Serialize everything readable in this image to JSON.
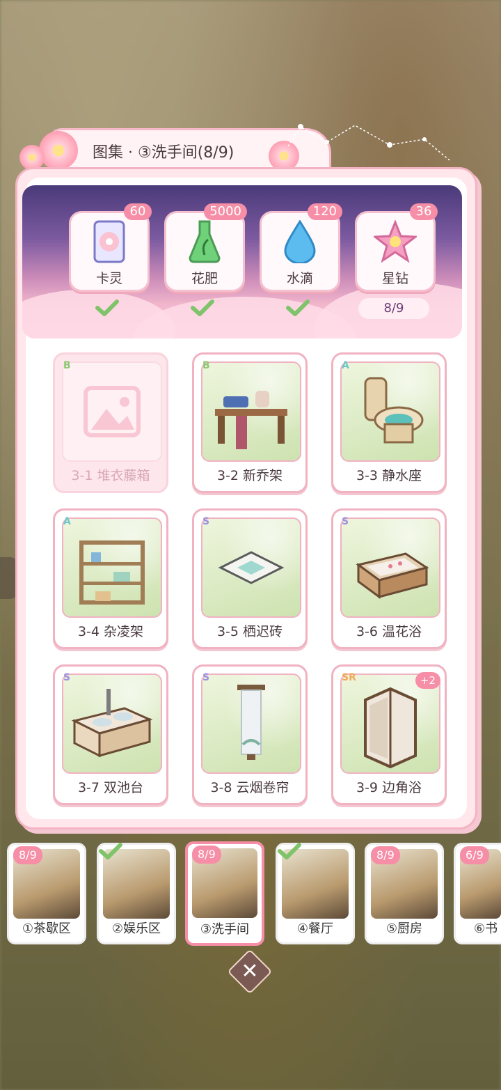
{
  "title": "图集 · ③洗手间(8/9)",
  "resources": [
    {
      "label": "卡灵",
      "badge": "60",
      "icon": "card-spirit-icon",
      "completed": true
    },
    {
      "label": "花肥",
      "badge": "5000",
      "icon": "fertilizer-flask-icon",
      "completed": true
    },
    {
      "label": "水滴",
      "badge": "120",
      "icon": "water-drop-icon",
      "completed": true
    },
    {
      "label": "星钻",
      "badge": "36",
      "icon": "star-diamond-icon",
      "completed": false,
      "progress": "8/9"
    }
  ],
  "items": [
    {
      "rank": "B",
      "name": "3-1 堆衣藤箱",
      "locked": true,
      "rank_color": "#8fc873"
    },
    {
      "rank": "B",
      "name": "3-2 新乔架",
      "locked": false,
      "rank_color": "#8fc873"
    },
    {
      "rank": "A",
      "name": "3-3 静水座",
      "locked": false,
      "rank_color": "#6cc7c9"
    },
    {
      "rank": "A",
      "name": "3-4 杂凌架",
      "locked": false,
      "rank_color": "#6cc7c9"
    },
    {
      "rank": "S",
      "name": "3-5 栖迟砖",
      "locked": false,
      "rank_color": "#9c92e0"
    },
    {
      "rank": "S",
      "name": "3-6 温花浴",
      "locked": false,
      "rank_color": "#9c92e0"
    },
    {
      "rank": "S",
      "name": "3-7 双池台",
      "locked": false,
      "rank_color": "#9c92e0"
    },
    {
      "rank": "S",
      "name": "3-8 云烟卷帘",
      "locked": false,
      "rank_color": "#9c92e0"
    },
    {
      "rank": "SR",
      "name": "3-9 边角浴",
      "locked": false,
      "rank_color": "#f2a85a",
      "plus": "+2"
    }
  ],
  "tabs": [
    {
      "label": "①茶歇区",
      "badge": "8/9",
      "done": false,
      "active": false
    },
    {
      "label": "②娱乐区",
      "badge": "",
      "done": true,
      "active": false
    },
    {
      "label": "③洗手间",
      "badge": "8/9",
      "done": false,
      "active": true
    },
    {
      "label": "④餐厅",
      "badge": "",
      "done": true,
      "active": false
    },
    {
      "label": "⑤厨房",
      "badge": "8/9",
      "done": false,
      "active": false
    },
    {
      "label": "⑥书",
      "badge": "6/9",
      "done": false,
      "active": false
    }
  ],
  "close_icon": "close-icon",
  "colors": {
    "accent_pink": "#f58ea6",
    "check_green": "#7fc36a",
    "banner_purple": "#4a3a7a"
  }
}
